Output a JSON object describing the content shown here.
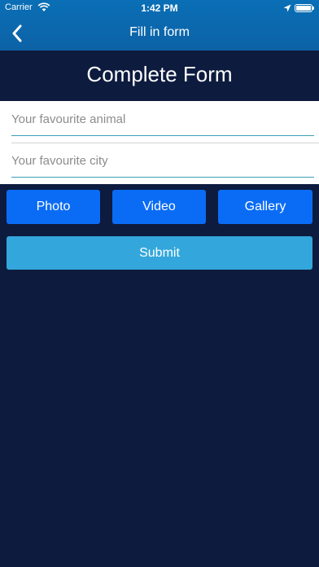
{
  "status_bar": {
    "carrier": "Carrier",
    "time": "1:42 PM",
    "battery_level": 1.0
  },
  "nav": {
    "title": "Fill in form",
    "back_icon": "chevron-left-icon"
  },
  "page": {
    "heading": "Complete Form"
  },
  "form": {
    "animal_placeholder": "Your favourite animal",
    "animal_value": "",
    "city_placeholder": "Your favourite city",
    "city_value": ""
  },
  "buttons": {
    "photo": "Photo",
    "video": "Video",
    "gallery": "Gallery",
    "submit": "Submit"
  },
  "colors": {
    "background": "#0d1b3e",
    "nav_blue": "#0d62a6",
    "button_blue": "#0a6cf5",
    "submit_blue": "#33a7db",
    "field_underline": "#3aa0b6"
  }
}
